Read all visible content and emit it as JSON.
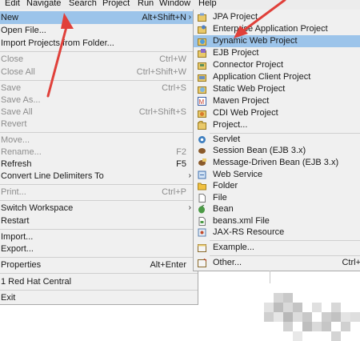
{
  "menubar": {
    "items": [
      "Edit",
      "Navigate",
      "Search",
      "Project",
      "Run",
      "Window",
      "Help"
    ]
  },
  "file_menu": {
    "items": [
      {
        "label": "New",
        "shortcut": "Alt+Shift+N",
        "submenu": true,
        "highlighted": true
      },
      {
        "label": "Open File..."
      },
      {
        "label": "Import Projects from Folder..."
      },
      {
        "label": "Close",
        "shortcut": "Ctrl+W",
        "disabled": true
      },
      {
        "label": "Close All",
        "shortcut": "Ctrl+Shift+W",
        "disabled": true
      },
      {
        "label": "Save",
        "shortcut": "Ctrl+S",
        "disabled": true
      },
      {
        "label": "Save As...",
        "disabled": true
      },
      {
        "label": "Save All",
        "shortcut": "Ctrl+Shift+S",
        "disabled": true
      },
      {
        "label": "Revert",
        "disabled": true
      },
      {
        "label": "Move...",
        "disabled": true
      },
      {
        "label": "Rename...",
        "shortcut": "F2",
        "disabled": true
      },
      {
        "label": "Refresh",
        "shortcut": "F5"
      },
      {
        "label": "Convert Line Delimiters To",
        "submenu": true
      },
      {
        "label": "Print...",
        "shortcut": "Ctrl+P",
        "disabled": true
      },
      {
        "label": "Switch Workspace",
        "submenu": true
      },
      {
        "label": "Restart"
      },
      {
        "label": "Import..."
      },
      {
        "label": "Export..."
      },
      {
        "label": "Properties",
        "shortcut": "Alt+Enter"
      },
      {
        "label": "1 Red Hat Central"
      },
      {
        "label": "Exit"
      }
    ]
  },
  "new_submenu": {
    "items": [
      {
        "label": "JPA Project",
        "icon": "jpa-project-icon"
      },
      {
        "label": "Enterprise Application Project",
        "icon": "enterprise-app-icon"
      },
      {
        "label": "Dynamic Web Project",
        "icon": "dynamic-web-project-icon",
        "highlighted": true
      },
      {
        "label": "EJB Project",
        "icon": "ejb-project-icon"
      },
      {
        "label": "Connector Project",
        "icon": "connector-project-icon"
      },
      {
        "label": "Application Client Project",
        "icon": "app-client-project-icon"
      },
      {
        "label": "Static Web Project",
        "icon": "static-web-project-icon"
      },
      {
        "label": "Maven Project",
        "icon": "maven-project-icon"
      },
      {
        "label": "CDI Web Project",
        "icon": "cdi-web-project-icon"
      },
      {
        "label": "Project...",
        "icon": "project-icon"
      },
      {
        "label": "Servlet",
        "icon": "servlet-icon"
      },
      {
        "label": "Session Bean (EJB 3.x)",
        "icon": "session-bean-icon"
      },
      {
        "label": "Message-Driven Bean (EJB 3.x)",
        "icon": "message-driven-bean-icon"
      },
      {
        "label": "Web Service",
        "icon": "web-service-icon"
      },
      {
        "label": "Folder",
        "icon": "folder-icon"
      },
      {
        "label": "File",
        "icon": "file-icon"
      },
      {
        "label": "Bean",
        "icon": "bean-icon"
      },
      {
        "label": "beans.xml File",
        "icon": "beans-xml-icon"
      },
      {
        "label": "JAX-RS Resource",
        "icon": "jax-rs-icon"
      },
      {
        "label": "Example...",
        "icon": "example-icon"
      },
      {
        "label": "Other...",
        "shortcut": "Ctrl+",
        "icon": "other-icon"
      }
    ]
  },
  "colors": {
    "menu_bg": "#f0f0f0",
    "highlight": "#9cc4ea",
    "disabled_text": "#8d8d8d",
    "annotation_arrow": "#e0403a"
  }
}
